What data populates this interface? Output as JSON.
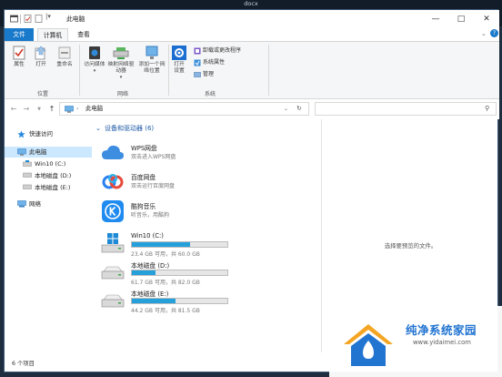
{
  "top_caption": "docx",
  "window": {
    "title": "此电脑"
  },
  "colors": {
    "accent": "#1979ca",
    "bar_fill": "#26a0da",
    "group_heading": "#1e5aa8"
  },
  "tabs": [
    {
      "label": "文件",
      "active": false
    },
    {
      "label": "计算机",
      "active": true
    },
    {
      "label": "查看",
      "active": false
    }
  ],
  "ribbon": {
    "location": {
      "label": "位置",
      "buttons": [
        {
          "label": "属性",
          "icon": "checkmark-icon"
        },
        {
          "label": "打开",
          "icon": "open-icon"
        },
        {
          "label": "重命名",
          "icon": "rename-icon"
        }
      ]
    },
    "network": {
      "label": "网络",
      "buttons": [
        {
          "label": "访问媒体",
          "icon": "media-icon"
        },
        {
          "label": "映射网络驱动器",
          "icon": "network-drive-icon"
        },
        {
          "label": "添加一个网络位置",
          "icon": "network-location-icon"
        }
      ]
    },
    "system": {
      "label": "系统",
      "open_settings": "打开设置",
      "items": [
        {
          "label": "卸载或更改程序",
          "icon": "uninstall-icon"
        },
        {
          "label": "系统属性",
          "icon": "system-properties-icon"
        },
        {
          "label": "管理",
          "icon": "manage-icon"
        }
      ]
    }
  },
  "address": {
    "path": "此电脑",
    "search_placeholder": ""
  },
  "sidebar": {
    "items": [
      {
        "label": "快速访问",
        "icon": "star-icon"
      },
      {
        "label": "此电脑",
        "icon": "computer-icon",
        "selected": true
      },
      {
        "label": "Win10 (C:)",
        "icon": "windows-drive-icon"
      },
      {
        "label": "本地磁盘 (D:)",
        "icon": "drive-icon"
      },
      {
        "label": "本地磁盘 (E:)",
        "icon": "drive-icon"
      },
      {
        "label": "网络",
        "icon": "network-icon"
      }
    ]
  },
  "content": {
    "group_title": "设备和驱动器 (6)",
    "items": [
      {
        "name": "WPS网盘",
        "subtitle": "双击进入WPS网盘",
        "icon": "wps-cloud-icon"
      },
      {
        "name": "百度网盘",
        "subtitle": "双击运行百度网盘",
        "icon": "baidu-cloud-icon"
      },
      {
        "name": "酷狗音乐",
        "subtitle": "听音乐，用酷狗",
        "icon": "kugou-icon"
      }
    ],
    "drives": [
      {
        "name": "Win10 (C:)",
        "status": "23.4 GB 可用，共 60.0 GB",
        "used_percent": 61,
        "icon": "windows-drive-icon"
      },
      {
        "name": "本地磁盘 (D:)",
        "status": "61.7 GB 可用，共 82.0 GB",
        "used_percent": 25,
        "icon": "drive-icon"
      },
      {
        "name": "本地磁盘 (E:)",
        "status": "44.2 GB 可用，共 81.5 GB",
        "used_percent": 46,
        "icon": "drive-icon"
      }
    ]
  },
  "preview": {
    "message": "选择要预览的文件。"
  },
  "status": {
    "count": "6 个项目"
  },
  "watermark": {
    "name": "纯净系统家园",
    "url": "www.yidaimei.com"
  }
}
